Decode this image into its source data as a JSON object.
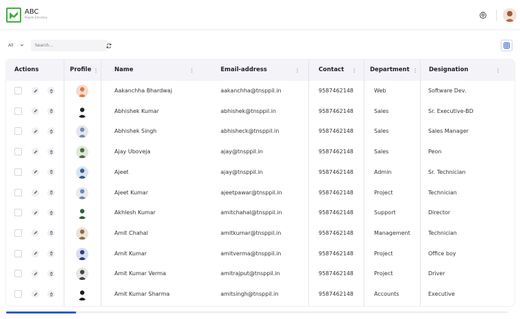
{
  "header": {
    "brand_title": "ABC",
    "brand_subtitle": "People Directory"
  },
  "filters": {
    "select_value": "All",
    "search_placeholder": "Search..."
  },
  "table": {
    "columns": {
      "actions": "Actions",
      "profile": "Profile",
      "name": "Name",
      "email": "Email-address",
      "contact": "Contact",
      "department": "Department",
      "designation": "Designation"
    },
    "rows": [
      {
        "name": "Aakanchha Bhardwaj",
        "email": "aakanchha@tnsppil.in",
        "contact": "9587462148",
        "department": "Web",
        "designation": "Software Dev.",
        "avatar_bg": "#f7d9cf",
        "avatar_fg": "#e07a3a"
      },
      {
        "name": "Abhishek Kumar",
        "email": "abhishek@tnsppil.in",
        "contact": "9587462148",
        "department": "Sales",
        "designation": "Sr. Executive-BD",
        "avatar_bg": "#ffffff",
        "avatar_fg": "#222222"
      },
      {
        "name": "Abhishek Singh",
        "email": "abhisheck@tnsppil.in",
        "contact": "9587462148",
        "department": "Sales",
        "designation": "Sales Manager",
        "avatar_bg": "#e4e7ef",
        "avatar_fg": "#7a8aa8"
      },
      {
        "name": "Ajay Uboveja",
        "email": "ajay@tnsppil.in",
        "contact": "9587462148",
        "department": "Sales",
        "designation": "Peon",
        "avatar_bg": "#dfe9d6",
        "avatar_fg": "#4b6b3a"
      },
      {
        "name": "Ajeet",
        "email": "ajay@tnsppil.in",
        "contact": "9587462148",
        "department": "Admin",
        "designation": "Sr. Technician",
        "avatar_bg": "#d6e4f2",
        "avatar_fg": "#3b5d86"
      },
      {
        "name": "Ajeet Kumar",
        "email": "ajeetpawar@tnsppil.in",
        "contact": "9587462148",
        "department": "Project",
        "designation": "Technician",
        "avatar_bg": "#e9e9ee",
        "avatar_fg": "#6f89b5"
      },
      {
        "name": "Akhlesh Kumar",
        "email": "amitchahal@tnsppil.in",
        "contact": "9587462148",
        "department": "Support",
        "designation": "Director",
        "avatar_bg": "#ffffff",
        "avatar_fg": "#2d5e3d"
      },
      {
        "name": "Amit Chahal",
        "email": "amitkumar@tnsppil.in",
        "contact": "9587462148",
        "department": "Management",
        "designation": "Technician",
        "avatar_bg": "#ece3d8",
        "avatar_fg": "#8a6a4a"
      },
      {
        "name": "Amit Kumar",
        "email": "amitverma@tnsppil.in",
        "contact": "9587462148",
        "department": "Project",
        "designation": "Office boy",
        "avatar_bg": "#d9dff0",
        "avatar_fg": "#2b3f7a"
      },
      {
        "name": "Amit Kumar Verma",
        "email": "amitrajput@tnsppil.in",
        "contact": "9587462148",
        "department": "Project",
        "designation": "Driver",
        "avatar_bg": "#e6e6e6",
        "avatar_fg": "#444444"
      },
      {
        "name": "Amit Kumar Sharma",
        "email": "amitsingh@tnsppil.in",
        "contact": "9587462148",
        "department": "Accounts",
        "designation": "Executive",
        "avatar_bg": "#ffffff",
        "avatar_fg": "#1e1e1e"
      }
    ]
  },
  "colors": {
    "accent": "#2a5ec9",
    "logo_green": "#3fae3a",
    "header_bg": "#f3f3f8"
  },
  "icons": [
    "gear-icon",
    "avatar",
    "chevron-down-icon",
    "refresh-icon",
    "grid-view-icon",
    "edit-icon",
    "delete-icon",
    "column-menu-icon"
  ]
}
